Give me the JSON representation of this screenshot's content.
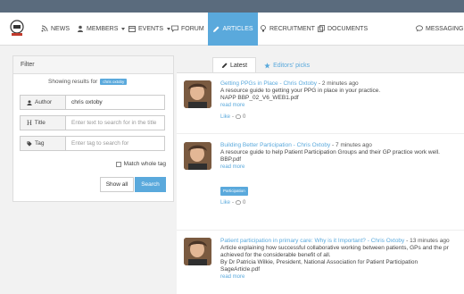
{
  "nav": {
    "items": [
      {
        "label": "NEWS",
        "icon": "rss-icon"
      },
      {
        "label": "MEMBERS",
        "icon": "users-icon"
      },
      {
        "label": "EVENTS",
        "icon": "calendar-icon"
      },
      {
        "label": "FORUM",
        "icon": "chat-icon"
      },
      {
        "label": "ARTICLES",
        "icon": "pencil-icon"
      },
      {
        "label": "RECRUITMENT",
        "icon": "bulb-icon"
      },
      {
        "label": "DOCUMENTS",
        "icon": "copy-icon"
      },
      {
        "label": "MESSAGING",
        "icon": "message-icon"
      }
    ],
    "active": "ARTICLES"
  },
  "filter": {
    "title": "Filter",
    "showing_text": "Showing results for",
    "showing_tag": "chris oxtoby",
    "author_label": "Author",
    "author_value": "chris oxtoby",
    "title_label": "Title",
    "title_placeholder": "Enter text to search for in the title",
    "tag_label": "Tag",
    "tag_placeholder": "Enter tag to search for",
    "match_label": "Match whole tag",
    "show_all": "Show all",
    "search": "Search"
  },
  "tabs": {
    "latest": "Latest",
    "editors_picks": "Editors' picks"
  },
  "posts": [
    {
      "title": "Getting PPGs in Place",
      "author": "Chris Oxtoby",
      "time": "2 minutes ago",
      "desc": "A resource guide to getting your PPG in place in your practice.",
      "file": "NAPP BBP_02_V6_WEB1.pdf",
      "read_more": "read more",
      "like": "Like",
      "comments": "0"
    },
    {
      "title": "Building Better Participation",
      "author": "Chris Oxtoby",
      "time": "7 minutes ago",
      "desc": "A resource guide to help Patient Participation Groups and their GP practice work well.",
      "file": "BBP.pdf",
      "read_more": "read more",
      "tag": "Participation",
      "like": "Like",
      "comments": "0"
    },
    {
      "title": "Patient participation in primary care: Why is it Important?",
      "author": "Chris Oxtoby",
      "time": "13 minutes ago",
      "desc": "Article explaining how successful collaborative working between patients, GPs and the pr",
      "desc2": "achieved for the considerable benefit of all.",
      "byline": "By Dr Patricia Wilkie, President, National Association for Patient Participation",
      "file": "SageArticle.pdf",
      "read_more": "read more"
    }
  ],
  "colors": {
    "accent": "#5aa9dc",
    "topbar": "#5a6b7d"
  }
}
